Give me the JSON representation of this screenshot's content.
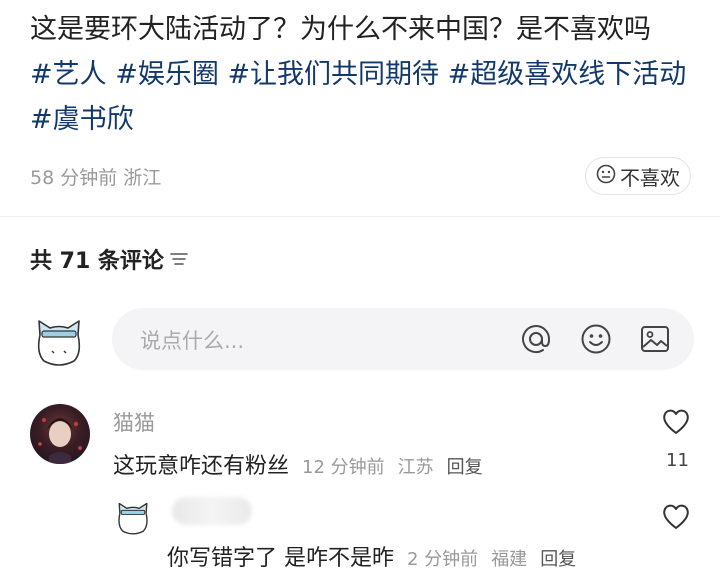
{
  "post": {
    "text": "这是要环大陆活动了？为什么不来中国？是不喜欢吗",
    "tags": [
      "#艺人",
      "#娱乐圈",
      "#让我们共同期待",
      "#超级喜欢线下活动",
      "#虞书欣"
    ],
    "time_location": "58 分钟前 浙江",
    "dislike_label": "不喜欢"
  },
  "comments_header": {
    "label": "共 71 条评论"
  },
  "comment_input": {
    "placeholder": "说点什么..."
  },
  "comments": [
    {
      "name": "猫猫",
      "text": "这玩意咋还有粉丝",
      "time": "12 分钟前",
      "location": "江苏",
      "reply_label": "回复",
      "likes": "11"
    }
  ],
  "replies": [
    {
      "text": "你写错字了 是咋不是昨",
      "time": "2 分钟前",
      "location": "福建",
      "reply_label": "回复"
    }
  ],
  "colors": {
    "tag": "#13386c",
    "meta": "#9a9a9a",
    "input_bg": "#f4f4f6"
  }
}
